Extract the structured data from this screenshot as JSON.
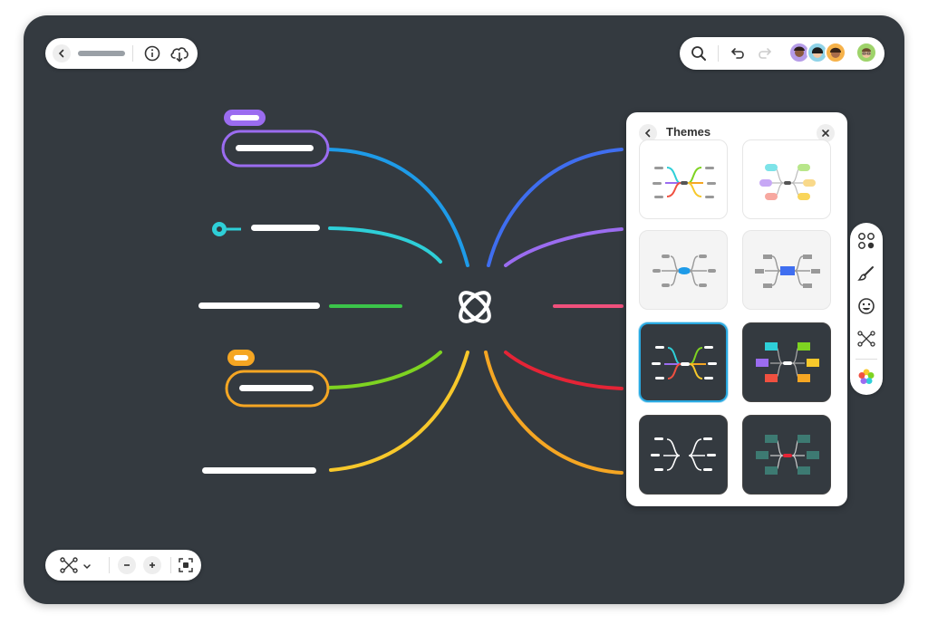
{
  "panel": {
    "title": "Themes"
  },
  "themes": [
    {
      "name": "colorful-lines-light"
    },
    {
      "name": "colorful-boxes-light"
    },
    {
      "name": "blue-lines-gray"
    },
    {
      "name": "blue-boxes-gray"
    },
    {
      "name": "colorful-lines-dark",
      "selected": true
    },
    {
      "name": "colorful-boxes-dark"
    },
    {
      "name": "white-lines-dark"
    },
    {
      "name": "teal-boxes-dark"
    }
  ],
  "toolbar_icons": [
    "back-icon",
    "info-icon",
    "cloud-download-icon",
    "search-icon",
    "undo-icon",
    "redo-icon",
    "layout-icon",
    "zoom-out-icon",
    "zoom-in-icon",
    "fit-screen-icon"
  ],
  "side_tools": [
    "layout-grid-icon",
    "brush-icon",
    "emoji-icon",
    "structure-icon",
    "theme-palette-icon"
  ],
  "colors": {
    "canvas": "#343a40",
    "purple": "#9b6cf0",
    "orange": "#f5a623",
    "cyan": "#2ecfd8",
    "green": "#3bc44a",
    "blue": "#1e9be8",
    "yellow": "#f7c82b",
    "red": "#e52436",
    "pink": "#f0507c",
    "selection": "#29a9e1"
  }
}
